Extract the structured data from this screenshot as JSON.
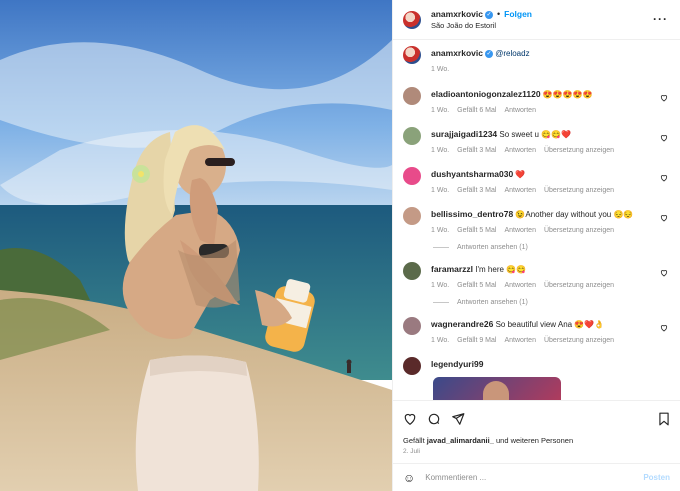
{
  "post": {
    "username": "anamxrkovic",
    "follow": "Folgen",
    "location": "São João do Estoril"
  },
  "caption": {
    "username": "anamxrkovic",
    "mention": "@reloadz",
    "time": "1 Wo."
  },
  "comments": [
    {
      "user": "eladioantoniogonzalez1120",
      "text": " 😍😍😍😍😍",
      "time": "1 Wo.",
      "likes": "Gefällt 6 Mal",
      "reply": "Antworten",
      "translate": "",
      "av": "#b08a7a"
    },
    {
      "user": "surajjaigadi1234",
      "text": " So sweet u 😋😋❤️",
      "time": "1 Wo.",
      "likes": "Gefällt 3 Mal",
      "reply": "Antworten",
      "translate": "Übersetzung anzeigen",
      "av": "#8aa27a"
    },
    {
      "user": "dushyantsharma030",
      "text": " ❤️",
      "time": "1 Wo.",
      "likes": "Gefällt 3 Mal",
      "reply": "Antworten",
      "translate": "Übersetzung anzeigen",
      "av": "#e84b8a"
    },
    {
      "user": "bellissimo_dentro78",
      "text": " 😉Another day without you 😔😔",
      "time": "1 Wo.",
      "likes": "Gefällt 5 Mal",
      "reply": "Antworten",
      "translate": "Übersetzung anzeigen",
      "av": "#c49a86",
      "more": "Antworten ansehen (1)"
    },
    {
      "user": "faramarzzl",
      "text": " I'm here 😋😋",
      "time": "1 Wo.",
      "likes": "Gefällt 5 Mal",
      "reply": "Antworten",
      "translate": "Übersetzung anzeigen",
      "av": "#5b6a4a",
      "more": "Antworten ansehen (1)"
    },
    {
      "user": "wagnerandre26",
      "text": " So beautiful view Ana 😍❤️👌",
      "time": "1 Wo.",
      "likes": "Gefällt 9 Mal",
      "reply": "Antworten",
      "translate": "Übersetzung anzeigen",
      "av": "#9a7a80"
    },
    {
      "user": "legendyuri99",
      "text": "",
      "time": "",
      "likes": "",
      "reply": "",
      "translate": "",
      "av": "#5a2a2a"
    }
  ],
  "likes": {
    "prefix": "Gefällt ",
    "user": "javad_alimardanii_",
    "suffix": " und weiteren Personen"
  },
  "date": "2. Juli",
  "composer": {
    "placeholder": "Kommentieren ...",
    "post": "Posten"
  }
}
